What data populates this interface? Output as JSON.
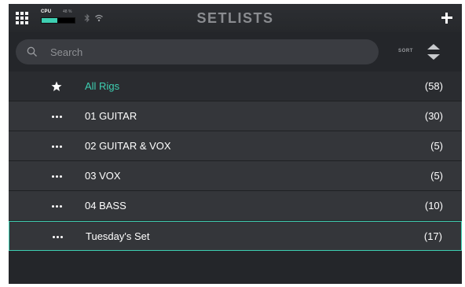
{
  "header": {
    "title": "SETLISTS",
    "cpu_label": "CPU",
    "cpu_percent_text": "48 %",
    "cpu_fraction": 0.48,
    "menu_icon": "grid-icon",
    "bluetooth_icon": "bluetooth-icon",
    "wifi_icon": "wifi-icon",
    "add_icon": "plus-icon"
  },
  "search": {
    "placeholder": "Search",
    "value": "",
    "sort_label": "SORT"
  },
  "setlists": [
    {
      "name": "All Rigs",
      "count": "(58)",
      "icon": "star-icon",
      "highlighted_text": true
    },
    {
      "name": "01 GUITAR",
      "count": "(30)",
      "icon": "more-icon"
    },
    {
      "name": "02 GUITAR & VOX",
      "count": "(5)",
      "icon": "more-icon"
    },
    {
      "name": "03 VOX",
      "count": "(5)",
      "icon": "more-icon"
    },
    {
      "name": "04 BASS",
      "count": "(10)",
      "icon": "more-icon"
    },
    {
      "name": "Tuesday's Set",
      "count": "(17)",
      "icon": "more-icon",
      "selected": true
    }
  ],
  "colors": {
    "accent": "#3ecfb2",
    "background": "#24262a",
    "row": "#34363a",
    "title": "#8a8c90"
  }
}
